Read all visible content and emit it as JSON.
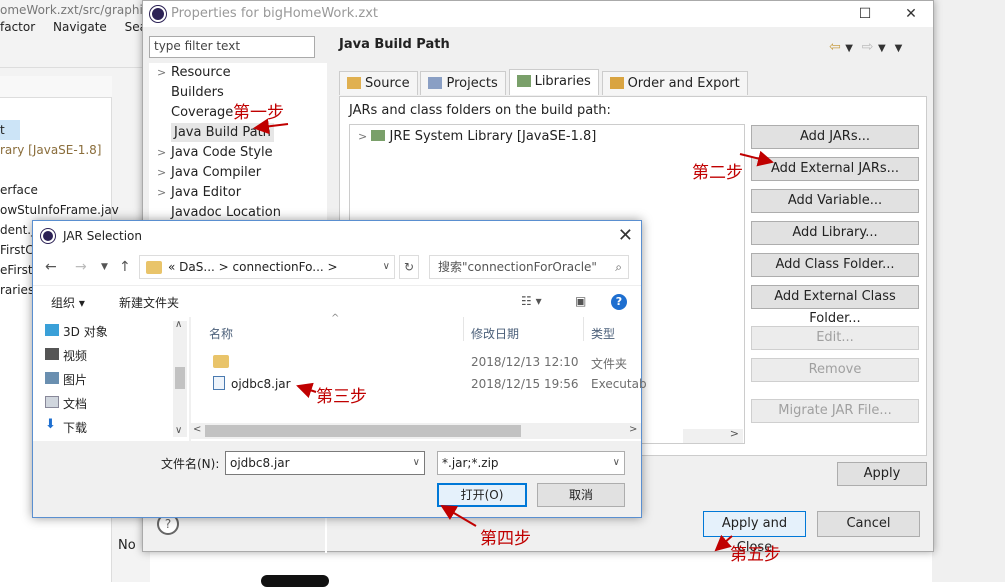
{
  "eclipse": {
    "title": "omeWork.zxt/src/graphic",
    "menu": [
      "factor",
      "Navigate",
      "Searc"
    ],
    "tree": [
      "t",
      "rary [JavaSE-1.8]",
      "",
      "erface",
      "owStuInfoFrame.jav",
      "dent.j",
      "FirstC",
      "eFirstF",
      "raries"
    ],
    "bottom_label": "No"
  },
  "properties": {
    "title": "Properties for bigHomeWork.zxt",
    "filter_placeholder": "type filter text",
    "nav": [
      {
        "label": "Resource",
        "arrow": ">"
      },
      {
        "label": "Builders",
        "arrow": ""
      },
      {
        "label": "Coverage",
        "arrow": ""
      },
      {
        "label": "Java Build Path",
        "arrow": ""
      },
      {
        "label": "Java Code Style",
        "arrow": ">"
      },
      {
        "label": "Java Compiler",
        "arrow": ">"
      },
      {
        "label": "Java Editor",
        "arrow": ">"
      },
      {
        "label": "Javadoc Location",
        "arrow": ""
      }
    ],
    "pane_title": "Java Build Path",
    "tabs": [
      "Source",
      "Projects",
      "Libraries",
      "Order and Export"
    ],
    "jars_label": "JARs and class folders on the build path:",
    "library_entry": "JRE System Library [JavaSE-1.8]",
    "buttons": [
      "Add JARs...",
      "Add External JARs...",
      "Add Variable...",
      "Add Library...",
      "Add Class Folder...",
      "Add External Class Folder...",
      "Edit...",
      "Remove",
      "Migrate JAR File..."
    ],
    "apply": "Apply",
    "apply_close": "Apply and Close",
    "cancel": "Cancel"
  },
  "jar_dialog": {
    "title": "JAR Selection",
    "path": [
      "«",
      "DaS...",
      ">",
      "connectionFo...",
      ">"
    ],
    "search_placeholder": "搜索\"connectionForOracle\"",
    "organize": "组织 ▾",
    "new_folder": "新建文件夹",
    "left_nav": [
      "3D 对象",
      "视频",
      "图片",
      "文档",
      "下载"
    ],
    "columns": [
      "名称",
      "修改日期",
      "类型"
    ],
    "files": [
      {
        "name": "",
        "date": "2018/12/13 12:10",
        "type": "文件夹"
      },
      {
        "name": "ojdbc8.jar",
        "date": "2018/12/15 19:56",
        "type": "Executab"
      }
    ],
    "filename_label": "文件名(N):",
    "filename_value": "ojdbc8.jar",
    "filetype_value": "*.jar;*.zip",
    "open": "打开(O)",
    "cancel": "取消"
  },
  "annotations": [
    "第一步",
    "第二步",
    "第三步",
    "第四步",
    "第五步"
  ],
  "colors": {
    "annotation": "#c00000",
    "accent": "#0078d7"
  }
}
